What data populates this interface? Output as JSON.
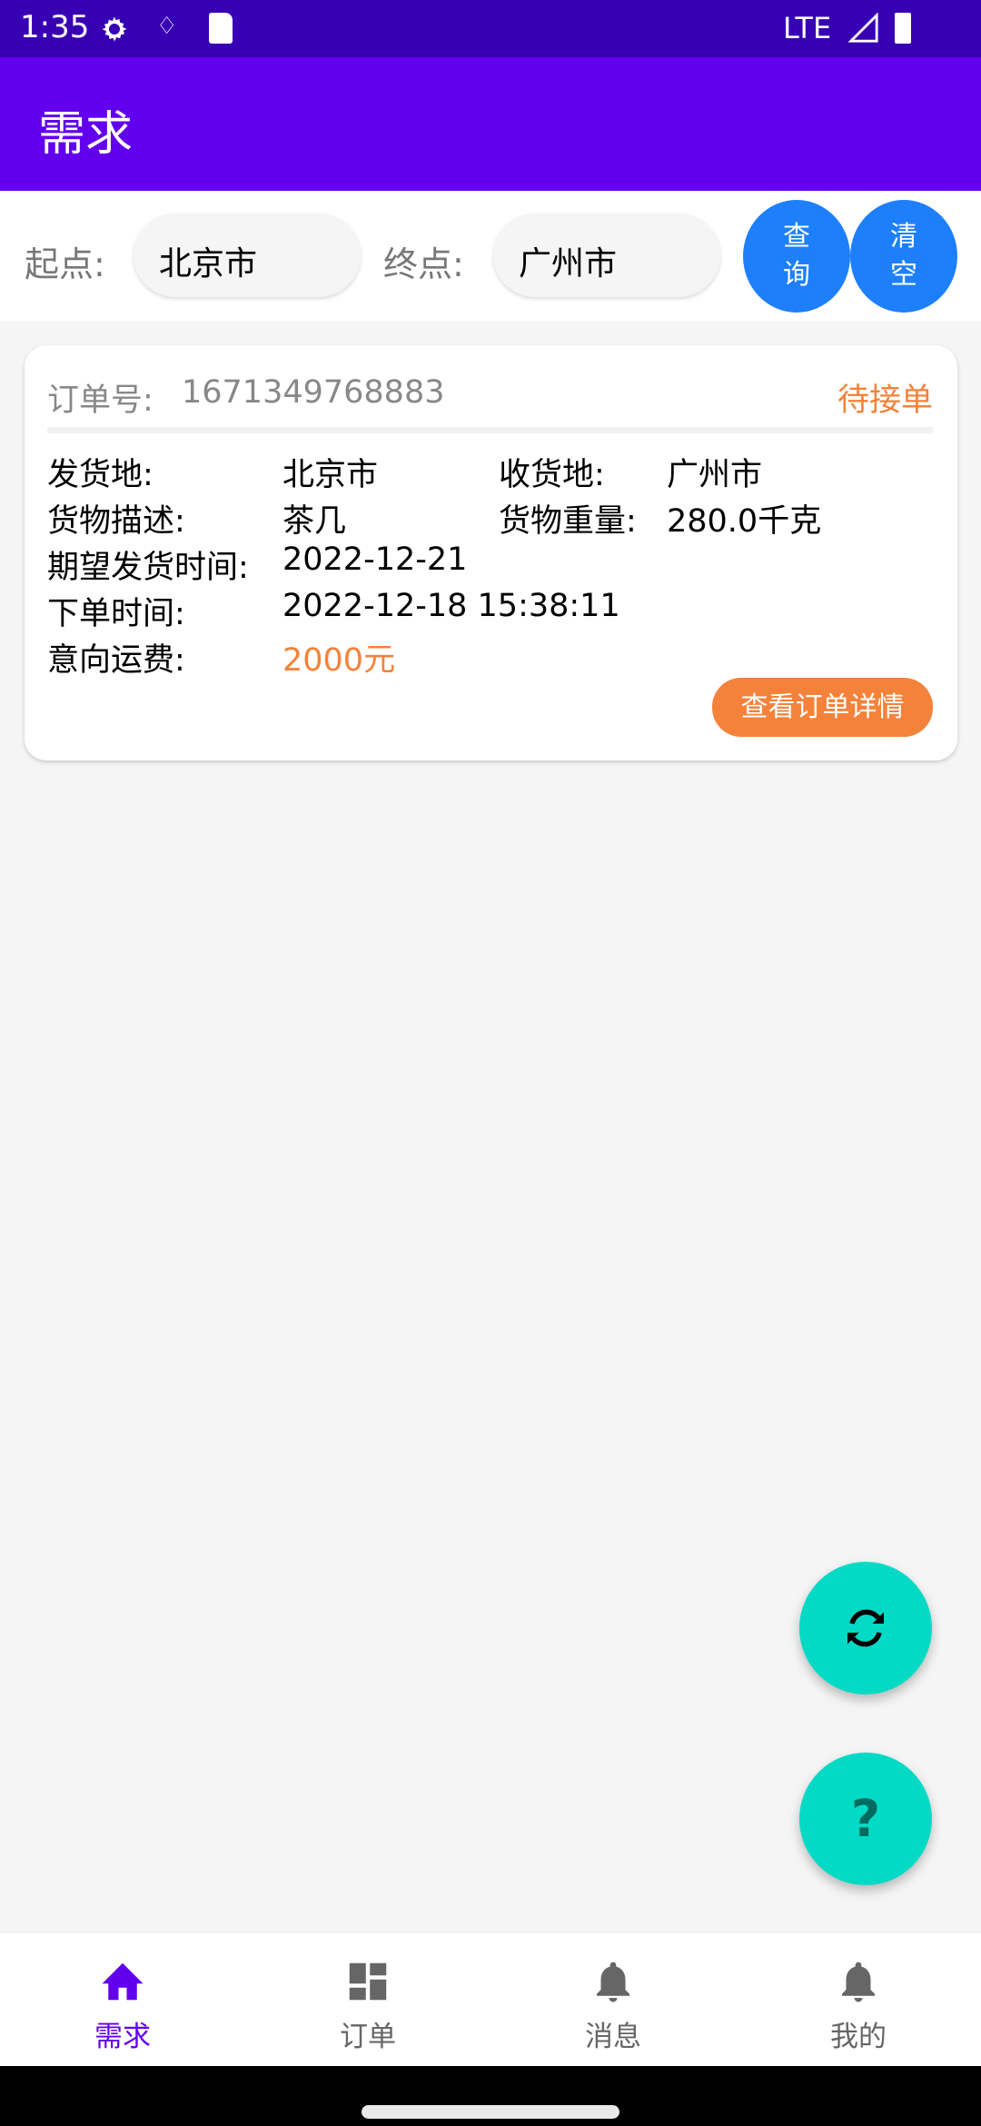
{
  "status_bar": {
    "time": "1:35",
    "network": "LTE"
  },
  "app_bar": {
    "title": "需求"
  },
  "search": {
    "origin_label": "起点:",
    "origin_value": "北京市",
    "dest_label": "终点:",
    "dest_value": "广州市",
    "query_button": "查询",
    "clear_button": "清空"
  },
  "order": {
    "number_label": "订单号:",
    "number": "1671349768883",
    "status": "待接单",
    "ship_from_label": "发货地:",
    "ship_from": "北京市",
    "ship_to_label": "收货地:",
    "ship_to": "广州市",
    "goods_label": "货物描述:",
    "goods": "茶几",
    "weight_label": "货物重量:",
    "weight": "280.0千克",
    "expected_label": "期望发货时间:",
    "expected": "2022-12-21",
    "created_label": "下单时间:",
    "created": "2022-12-18 15:38:11",
    "fee_label": "意向运费:",
    "fee": "2000元",
    "detail_button": "查看订单详情"
  },
  "fabs": {
    "refresh_icon": "refresh-icon",
    "help_icon": "help-icon"
  },
  "bottom_nav": [
    {
      "label": "需求",
      "icon": "home-icon",
      "active": true
    },
    {
      "label": "订单",
      "icon": "dashboard-icon"
    },
    {
      "label": "消息",
      "icon": "bell-icon"
    },
    {
      "label": "我的",
      "icon": "bell-icon"
    }
  ],
  "colors": {
    "primary": "#6200EE",
    "status": "#3700B3",
    "accent": "#03DAC5",
    "orange": "#F5823A",
    "blue": "#1E7FFB"
  }
}
